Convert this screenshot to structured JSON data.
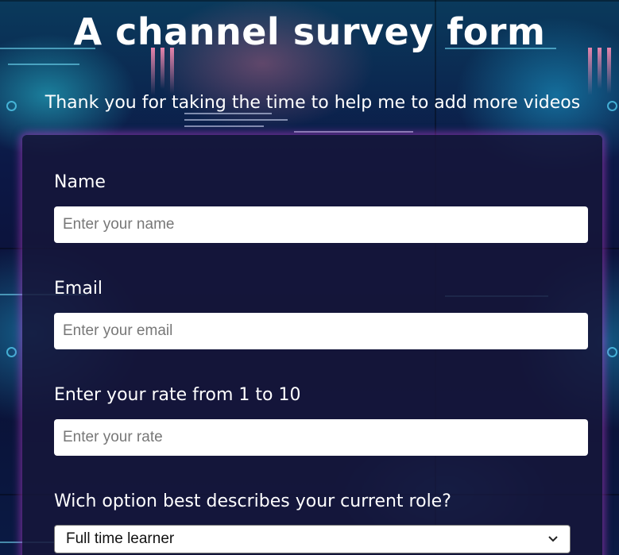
{
  "header": {
    "title": "A channel survey form",
    "subtitle": "Thank you for taking the time to help me to add more videos"
  },
  "form": {
    "name": {
      "label": "Name",
      "placeholder": "Enter your name",
      "value": ""
    },
    "email": {
      "label": "Email",
      "placeholder": "Enter your email",
      "value": ""
    },
    "rate": {
      "label": "Enter your rate from 1 to 10",
      "placeholder": "Enter your rate",
      "value": ""
    },
    "role": {
      "label": "Wich option best describes your current role?",
      "selected": "Full time learner",
      "chevron_icon": "chevron-down-icon"
    }
  },
  "colors": {
    "title_text": "#ffffff",
    "card_background": "#16163a",
    "card_glow": "#be3cd2",
    "input_background": "#ffffff",
    "placeholder_text": "#777777"
  }
}
